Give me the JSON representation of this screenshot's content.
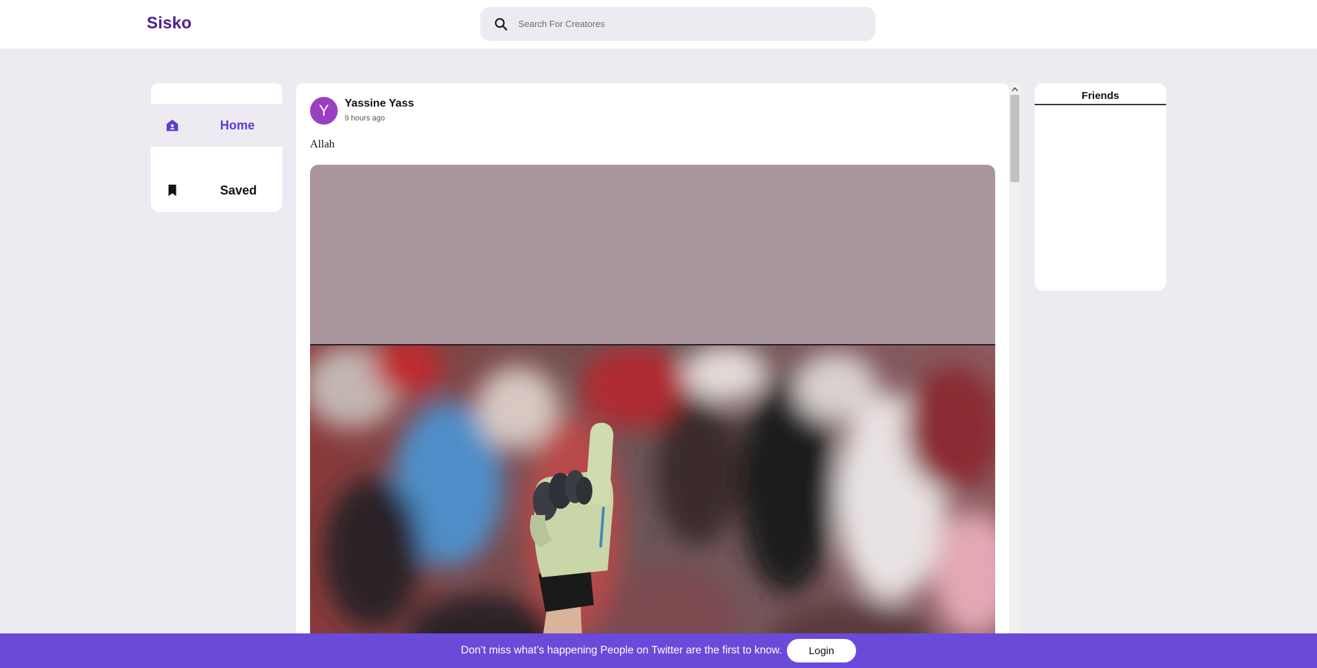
{
  "header": {
    "logo": "Sisko",
    "search": {
      "placeholder": "Search For Creatores",
      "icon": "search-icon"
    }
  },
  "sidebar": {
    "items": [
      {
        "label": "Home",
        "icon": "home-icon",
        "active": true
      },
      {
        "label": "Saved",
        "icon": "bookmark-icon",
        "active": false
      }
    ]
  },
  "post": {
    "avatar_initial": "Y",
    "author": "Yassine Yass",
    "time": "9 hours ago",
    "text": "Allah"
  },
  "friends": {
    "title": "Friends"
  },
  "banner": {
    "text": "Don’t miss what’s happening People on Twitter are the first to know.",
    "login_label": "Login"
  },
  "colors": {
    "accent": "#6a4ad8",
    "logo": "#4b1f8f",
    "active_nav": "#5a3fcf",
    "page_bg": "#eeeaf2",
    "avatar": "#9a3fc2"
  }
}
